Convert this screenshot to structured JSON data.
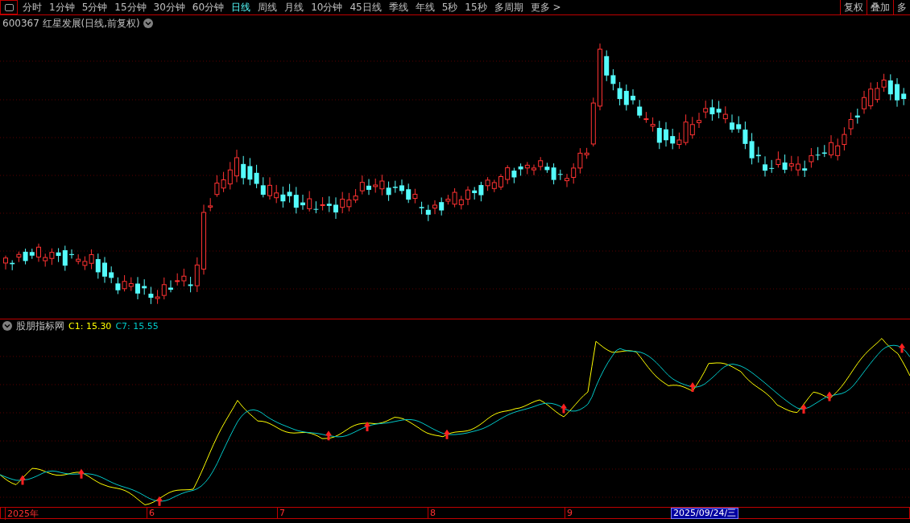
{
  "toolbar": {
    "periods": [
      {
        "label": "分时",
        "selected": false
      },
      {
        "label": "1分钟",
        "selected": false
      },
      {
        "label": "5分钟",
        "selected": false
      },
      {
        "label": "15分钟",
        "selected": false
      },
      {
        "label": "30分钟",
        "selected": false
      },
      {
        "label": "60分钟",
        "selected": false
      },
      {
        "label": "日线",
        "selected": true
      },
      {
        "label": "周线",
        "selected": false
      },
      {
        "label": "月线",
        "selected": false
      },
      {
        "label": "10分钟",
        "selected": false
      },
      {
        "label": "45日线",
        "selected": false
      },
      {
        "label": "季线",
        "selected": false
      },
      {
        "label": "年线",
        "selected": false
      },
      {
        "label": "5秒",
        "selected": false
      },
      {
        "label": "15秒",
        "selected": false
      },
      {
        "label": "多周期",
        "selected": false
      },
      {
        "label": "更多 >",
        "selected": false
      }
    ],
    "right_buttons": [
      "复权",
      "叠加",
      "多"
    ]
  },
  "stock_title": "600367 红星发展(日线,前复权)",
  "indicator": {
    "name": "股朋指标网",
    "readings": [
      {
        "label": "C1: 15.30",
        "color": "#ffff00"
      },
      {
        "label": "C7: 15.55",
        "color": "#00c8c8"
      }
    ]
  },
  "time_axis": {
    "labels": [
      "2025年",
      "6",
      "7",
      "8",
      "9"
    ],
    "cursor_date": "2025/09/24/三"
  }
}
